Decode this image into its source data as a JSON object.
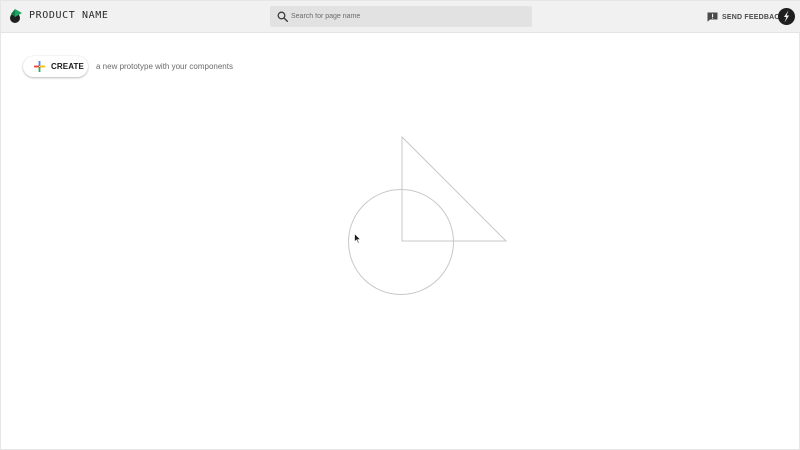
{
  "header": {
    "product_name": "PRODUCT NAME",
    "search": {
      "placeholder": "Search for page name",
      "value": ""
    },
    "feedback_label": "SEND FEEDBACK"
  },
  "main": {
    "create_label": "CREATE",
    "create_hint": "a new prototype with your components"
  },
  "icons": {
    "logo": "app-logo-icon",
    "search": "search-icon",
    "feedback": "feedback-icon",
    "plus": "plus-icon",
    "account": "account-avatar"
  },
  "colors": {
    "header_bg": "#f1f1f1",
    "search_bg": "#e2e2e2",
    "plus_blue": "#4285f4",
    "plus_green": "#34a853",
    "plus_yellow": "#fbbc05",
    "plus_red": "#ea4335",
    "shape_stroke": "#c8c8c8"
  }
}
